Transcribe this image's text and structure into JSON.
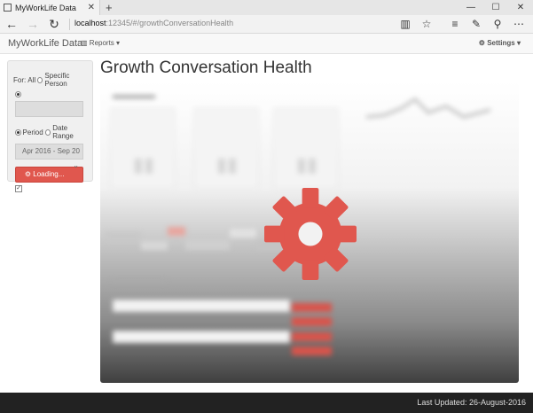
{
  "browser": {
    "tab_title": "MyWorkLife Data",
    "address_host": "localhost",
    "address_rest": ":12345/#/growthConversationHealth"
  },
  "navbar": {
    "brand": "MyWorkLife Data",
    "reports_label": "Reports",
    "settings_label": "Settings"
  },
  "sidebar": {
    "for_label": "For:",
    "all_label": "All",
    "specific_label": "Specific Person",
    "period_label": "Period",
    "date_range_label": "Date Range",
    "period_value": "Apr 2016 - Sep 20",
    "loading_label": "Loading..."
  },
  "page": {
    "title": "Growth Conversation Health"
  },
  "footer": {
    "last_updated": "Last Updated: 26-August-2016"
  },
  "colors": {
    "accent": "#e0574e",
    "footer": "#222222"
  },
  "icons": {
    "loading": "gear-icon"
  }
}
